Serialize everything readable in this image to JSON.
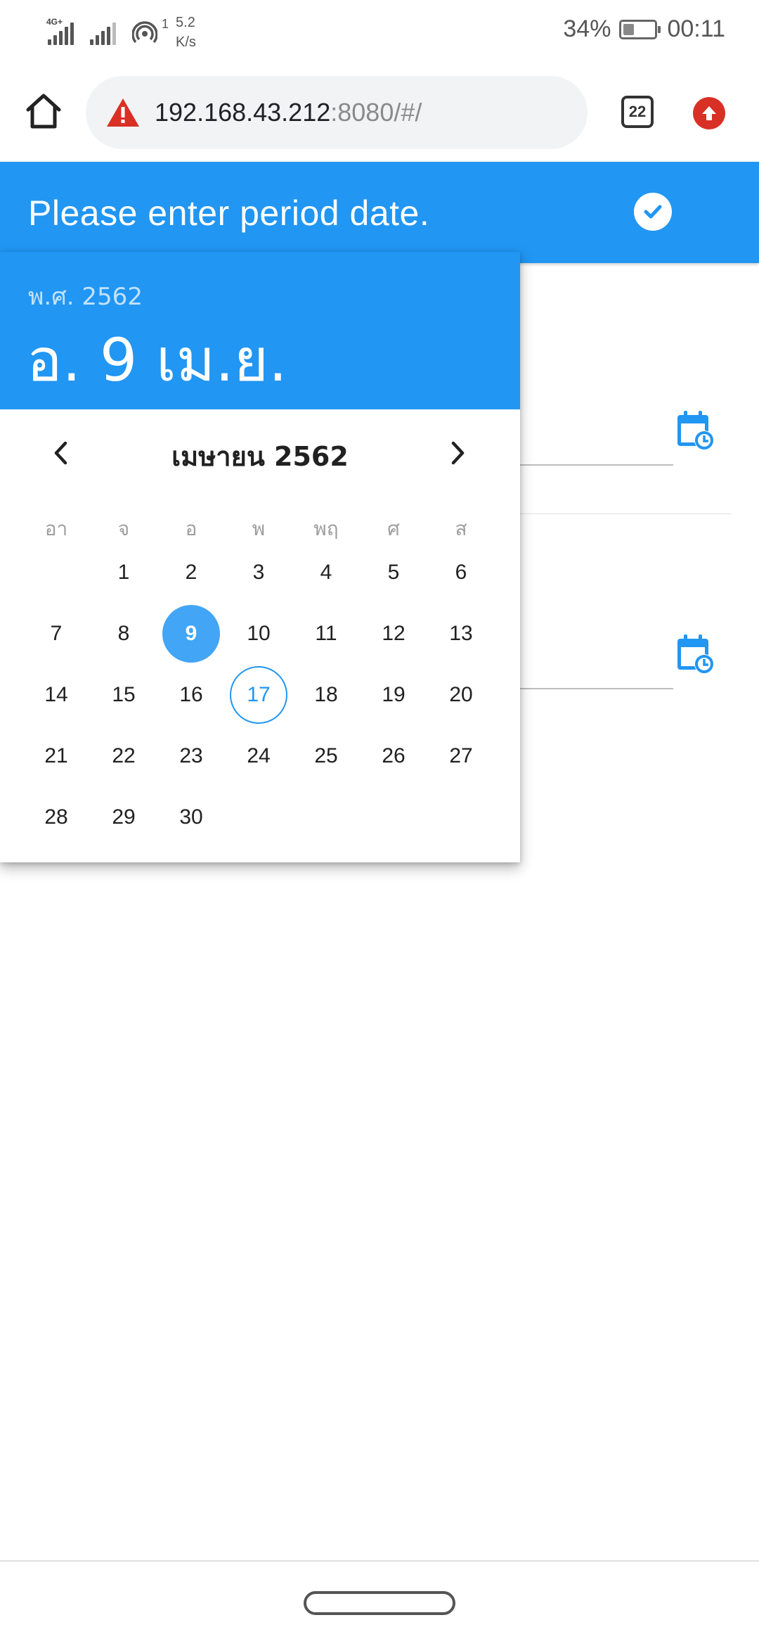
{
  "status_bar": {
    "network_type": "4G+",
    "speed_prefix": "1",
    "speed_value": "5.2",
    "speed_unit": "K/s",
    "battery": "34%",
    "time": "00:11"
  },
  "browser": {
    "url_host": "192.168.43.212",
    "url_rest": ":8080/#/",
    "tab_count": "22",
    "warning_icon": "warning-triangle-icon"
  },
  "app_bar": {
    "title": "Please enter period date.",
    "confirm_icon": "check-circle-icon"
  },
  "date_picker": {
    "year_label": "พ.ศ. 2562",
    "selected_date_label": "อ. 9 เม.ย.",
    "month_label": "เมษายน 2562",
    "weekdays": [
      "อา",
      "จ",
      "อ",
      "พ",
      "พฤ",
      "ศ",
      "ส"
    ],
    "weeks": [
      [
        "",
        "1",
        "2",
        "3",
        "4",
        "5",
        "6"
      ],
      [
        "7",
        "8",
        "9",
        "10",
        "11",
        "12",
        "13"
      ],
      [
        "14",
        "15",
        "16",
        "17",
        "18",
        "19",
        "20"
      ],
      [
        "21",
        "22",
        "23",
        "24",
        "25",
        "26",
        "27"
      ],
      [
        "28",
        "29",
        "30",
        "",
        "",
        "",
        ""
      ]
    ],
    "selected_day": "9",
    "today_day": "17"
  },
  "colors": {
    "primary": "#2196f3",
    "selected_day": "#42a5f5",
    "warning": "#d93025"
  }
}
